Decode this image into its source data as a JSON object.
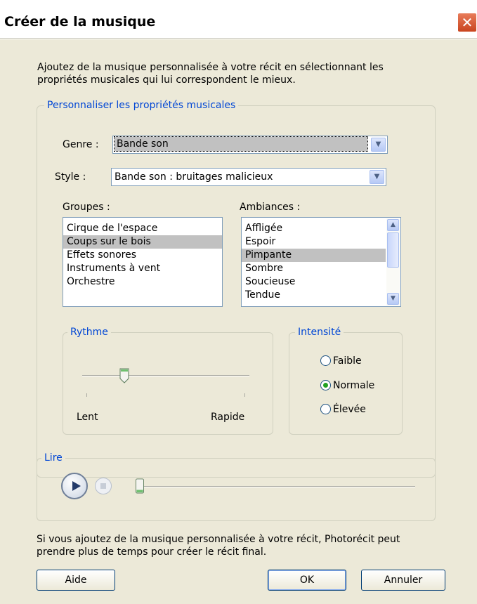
{
  "window": {
    "title": "Créer de la musique",
    "close_glyph": "✕"
  },
  "intro": {
    "line1": "Ajoutez de la musique personnalisée à votre récit en sélectionnant les",
    "line2": "propriétés musicales qui lui correspondent le mieux."
  },
  "properties_group": {
    "legend": "Personnaliser les propriétés musicales"
  },
  "genre": {
    "label": "Genre :",
    "value": "Bande son"
  },
  "style": {
    "label": "Style :",
    "value": "Bande son : bruitages malicieux"
  },
  "groups": {
    "label": "Groupes :",
    "items": [
      "Cirque de l'espace",
      "Coups sur le bois",
      "Effets sonores",
      "Instruments à vent",
      "Orchestre"
    ],
    "selected_index": 1
  },
  "moods": {
    "label": "Ambiances :",
    "items": [
      "Affligée",
      "Espoir",
      "Pimpante",
      "Sombre",
      "Soucieuse",
      "Tendue"
    ],
    "selected_index": 2
  },
  "rhythm": {
    "legend": "Rythme",
    "min_label": "Lent",
    "max_label": "Rapide",
    "value_fraction": 0.25
  },
  "intensity": {
    "legend": "Intensité",
    "options": [
      "Faible",
      "Normale",
      "Élevée"
    ],
    "selected": "Normale"
  },
  "play": {
    "legend": "Lire",
    "progress_fraction": 0.0
  },
  "footer": {
    "line1": "Si vous ajoutez de la musique personnalisée à votre récit, Photorécit peut",
    "line2": "prendre plus de temps pour créer le récit final."
  },
  "buttons": {
    "help": "Aide",
    "ok": "OK",
    "cancel": "Annuler"
  },
  "colors": {
    "accent": "#0046d5",
    "selection": "#c1c1c1",
    "radio_dot": "#21a121",
    "close": "#c9451f"
  }
}
